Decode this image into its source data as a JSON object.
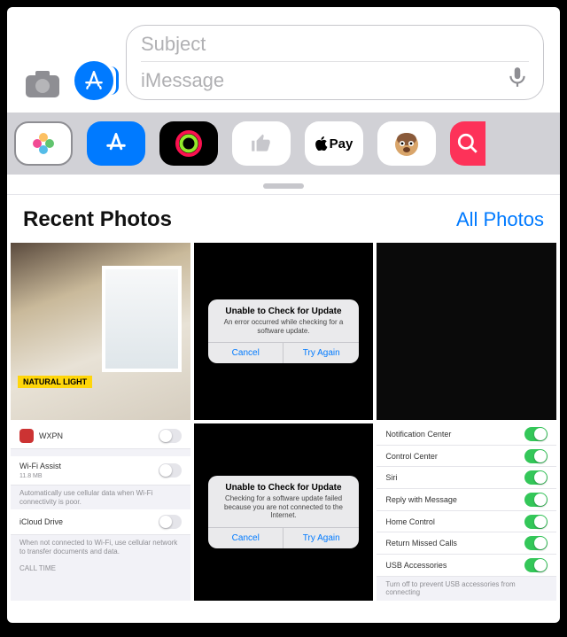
{
  "compose": {
    "subject_placeholder": "Subject",
    "message_placeholder": "iMessage"
  },
  "app_strip": {
    "apple_pay_label": "Pay"
  },
  "section": {
    "title": "Recent Photos",
    "link": "All Photos"
  },
  "tiles": {
    "natural_light_badge": "NATURAL LIGHT",
    "dialog1": {
      "title": "Unable to Check for Update",
      "body": "An error occurred while checking for a software update.",
      "cancel": "Cancel",
      "try_again": "Try Again"
    },
    "dialog2": {
      "title": "Unable to Check for Update",
      "body": "Checking for a software update failed because you are not connected to the Internet.",
      "cancel": "Cancel",
      "try_again": "Try Again"
    },
    "settings_left": {
      "wxpn": "WXPN",
      "wifi_assist": "Wi-Fi Assist",
      "wifi_size": "11.8 MB",
      "wifi_note": "Automatically use cellular data when Wi-Fi connectivity is poor.",
      "icloud_drive": "iCloud Drive",
      "icloud_note": "When not connected to Wi-Fi, use cellular network to transfer documents and data.",
      "call_time": "CALL TIME"
    },
    "settings_right": {
      "notification_center": "Notification Center",
      "control_center": "Control Center",
      "siri": "Siri",
      "reply_with_message": "Reply with Message",
      "home_control": "Home Control",
      "return_missed_calls": "Return Missed Calls",
      "usb_accessories": "USB Accessories",
      "usb_note": "Turn off to prevent USB accessories from connecting"
    }
  }
}
